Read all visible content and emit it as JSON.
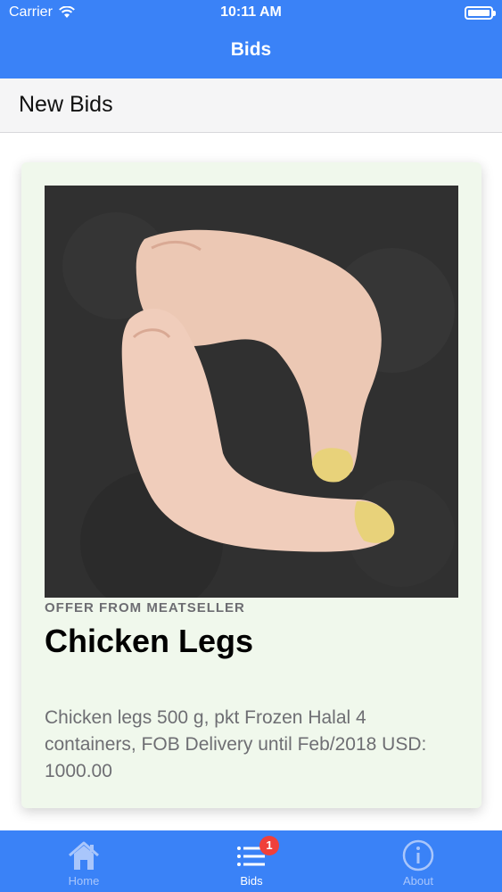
{
  "status_bar": {
    "carrier": "Carrier",
    "time": "10:11 AM"
  },
  "nav": {
    "title": "Bids"
  },
  "section": {
    "title": "New Bids"
  },
  "card": {
    "offer_label": "OFFER FROM MEATSELLER",
    "title": "Chicken Legs",
    "description": "Chicken legs 500 g, pkt Frozen Halal 4 containers, FOB Delivery until Feb/2018 USD: 1000.00",
    "background_color": "#f0f8ec"
  },
  "tabs": [
    {
      "label": "Home",
      "icon": "home-icon"
    },
    {
      "label": "Bids",
      "icon": "list-icon",
      "badge": "1"
    },
    {
      "label": "About",
      "icon": "info-icon"
    }
  ],
  "colors": {
    "accent": "#3a82f7",
    "badge": "#f0403a",
    "inactive_tab": "#a9c6fb"
  }
}
